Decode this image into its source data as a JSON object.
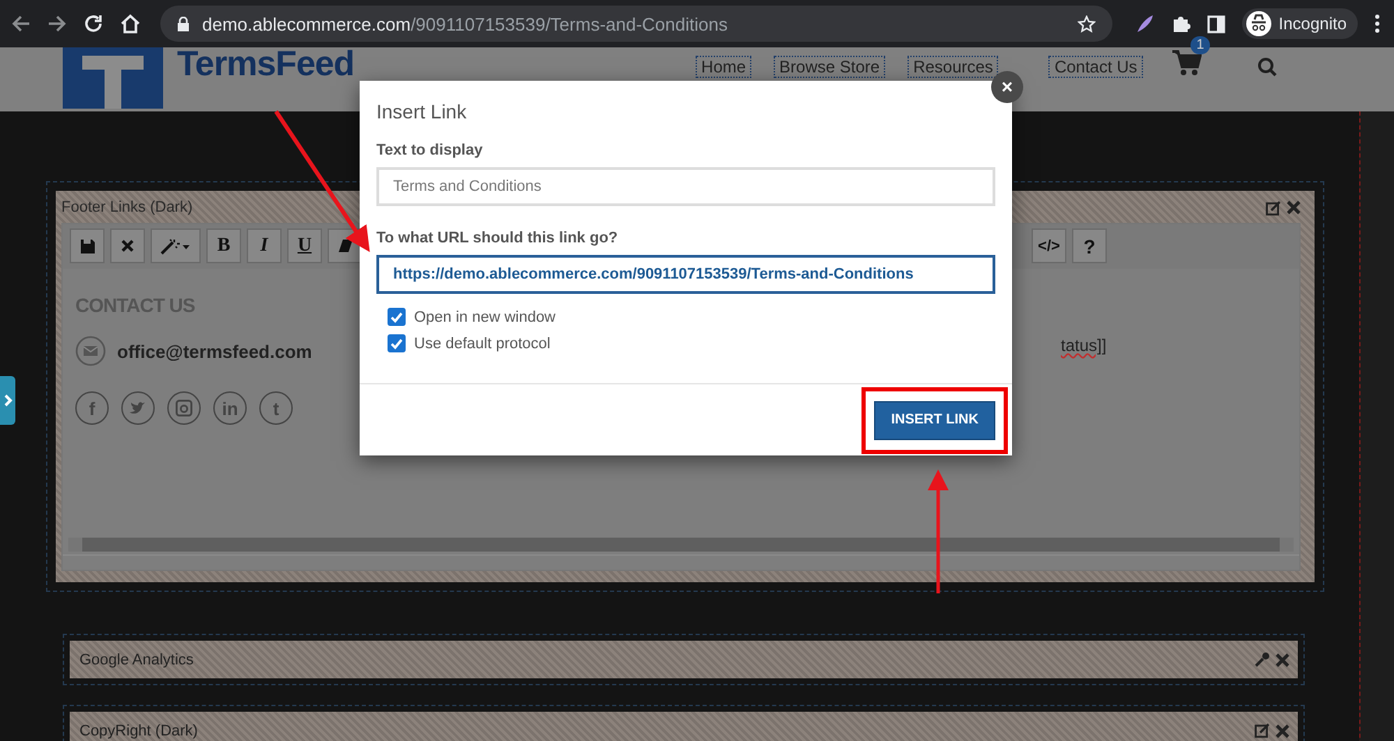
{
  "browser": {
    "url_host": "demo.ablecommerce.com",
    "url_path": "/9091107153539/Terms-and-Conditions",
    "profile": "Incognito"
  },
  "site": {
    "logo": "TermsFeed",
    "nav": [
      {
        "label": "Home"
      },
      {
        "label": "Browse Store"
      },
      {
        "label": "Resources"
      },
      {
        "label": "Contact Us"
      }
    ],
    "cart_count": "1"
  },
  "editor": {
    "title": "Footer Links (Dark)",
    "toolbar_left": [
      {
        "kind": "save"
      },
      {
        "kind": "remove"
      },
      {
        "kind": "magic"
      },
      {
        "kind": "bold",
        "label": "B"
      },
      {
        "kind": "italic",
        "label": "I"
      },
      {
        "kind": "underline",
        "label": "U"
      },
      {
        "kind": "eraser"
      }
    ],
    "toolbar_right": [
      {
        "kind": "code",
        "label": "</>"
      },
      {
        "kind": "help",
        "label": "?"
      }
    ],
    "heading": "CONTACT US",
    "email": "office@termsfeed.com",
    "fragment": "tatus]]",
    "social": [
      {
        "kind": "letter",
        "glyph": "f"
      },
      {
        "kind": "bird"
      },
      {
        "kind": "camera"
      },
      {
        "kind": "letter",
        "glyph": "in"
      },
      {
        "kind": "letter",
        "glyph": "t"
      }
    ]
  },
  "modal": {
    "title": "Insert Link",
    "close": "×",
    "text_label": "Text to display",
    "text_value": "Terms and Conditions",
    "url_label": "To what URL should this link go?",
    "url_value": "https://demo.ablecommerce.com/9091107153539/Terms-and-Conditions",
    "options": [
      {
        "label": "Open in new window",
        "checked": true
      },
      {
        "label": "Use default protocol",
        "checked": true
      }
    ],
    "button": "INSERT LINK"
  },
  "widgets": [
    {
      "title": "Google Analytics",
      "kind": "wrench"
    },
    {
      "title": "CopyRight (Dark)",
      "kind": "edit"
    }
  ]
}
